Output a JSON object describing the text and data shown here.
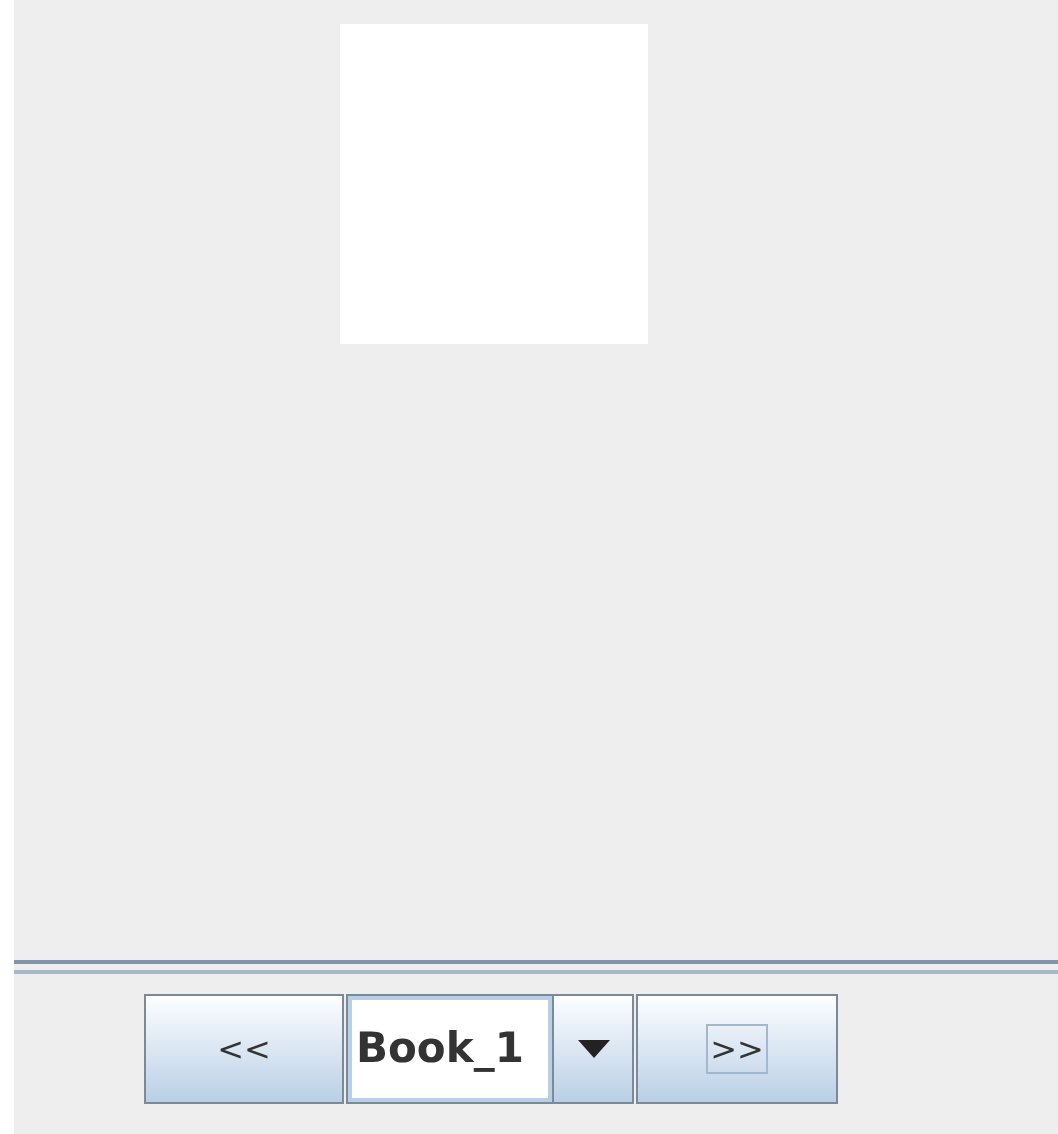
{
  "navigation": {
    "previous_button": {
      "label": "<<"
    },
    "book_select": {
      "value": "Book_1"
    },
    "next_button": {
      "label": ">>",
      "focused": true
    }
  }
}
